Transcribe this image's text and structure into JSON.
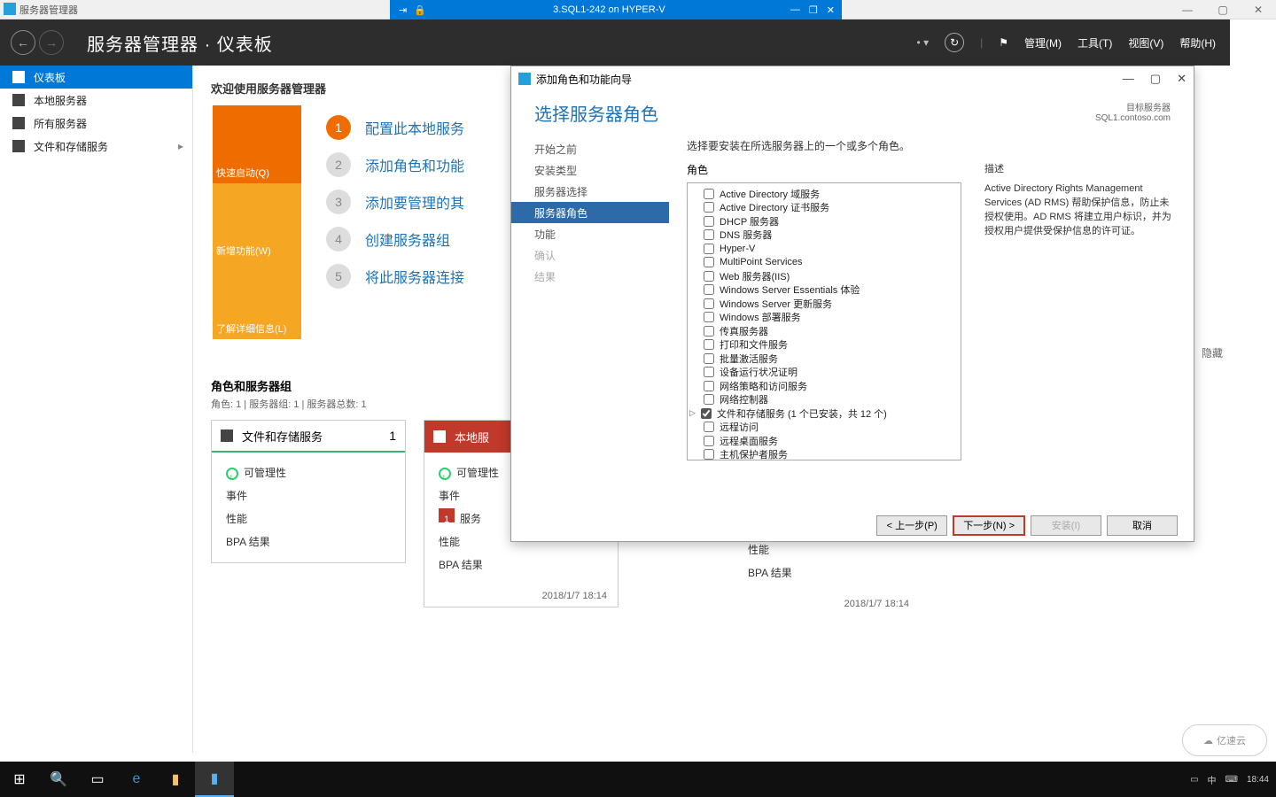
{
  "outer": {
    "app_name": "服务器管理器",
    "hv_title": "3.SQL1-242 on HYPER-V"
  },
  "header": {
    "breadcrumb_a": "服务器管理器",
    "breadcrumb_b": "仪表板",
    "menus": [
      "管理(M)",
      "工具(T)",
      "视图(V)",
      "帮助(H)"
    ]
  },
  "sidebar": {
    "items": [
      {
        "label": "仪表板"
      },
      {
        "label": "本地服务器"
      },
      {
        "label": "所有服务器"
      },
      {
        "label": "文件和存储服务"
      }
    ]
  },
  "main": {
    "welcome": "欢迎使用服务器管理器",
    "tiles": [
      {
        "label": "快速启动(Q)"
      },
      {
        "label": "新增功能(W)"
      },
      {
        "label": "了解详细信息(L)"
      }
    ],
    "steps": [
      "配置此本地服务",
      "添加角色和功能",
      "添加要管理的其",
      "创建服务器组",
      "将此服务器连接"
    ],
    "groups_title": "角色和服务器组",
    "groups_sub": "角色: 1 | 服务器组: 1 | 服务器总数: 1",
    "card1": {
      "title": "文件和存储服务",
      "count": "1",
      "rows": [
        "可管理性",
        "事件",
        "性能",
        "BPA 结果"
      ]
    },
    "card2": {
      "title": "本地服",
      "rows": [
        "可管理性",
        "事件",
        "服务",
        "性能",
        "BPA 结果"
      ],
      "badge": "1",
      "foot": "2018/1/7 18:14"
    },
    "card3": {
      "rows": [
        "性能",
        "BPA 结果"
      ],
      "foot": "2018/1/7 18:14"
    },
    "hide": "隐藏"
  },
  "wizard": {
    "title": "添加角色和功能向导",
    "head_title": "选择服务器角色",
    "target_label": "目标服务器",
    "target_value": "SQL1.contoso.com",
    "nav": [
      "开始之前",
      "安装类型",
      "服务器选择",
      "服务器角色",
      "功能",
      "确认",
      "结果"
    ],
    "intro": "选择要安装在所选服务器上的一个或多个角色。",
    "roles_label": "角色",
    "desc_label": "描述",
    "roles": [
      "Active Directory 域服务",
      "Active Directory 证书服务",
      "DHCP 服务器",
      "DNS 服务器",
      "Hyper-V",
      "MultiPoint Services",
      "Web 服务器(IIS)",
      "Windows Server Essentials 体验",
      "Windows Server 更新服务",
      "Windows 部署服务",
      "传真服务器",
      "打印和文件服务",
      "批量激活服务",
      "设备运行状况证明",
      "网络策略和访问服务",
      "网络控制器",
      "文件和存储服务 (1 个已安装，共 12 个)",
      "远程访问",
      "远程桌面服务",
      "主机保护者服务"
    ],
    "desc": "Active Directory Rights Management Services (AD RMS) 帮助保护信息，防止未授权使用。AD RMS 将建立用户标识，并为授权用户提供受保护信息的许可证。",
    "buttons": {
      "prev": "< 上一步(P)",
      "next": "下一步(N) >",
      "install": "安装(I)",
      "cancel": "取消"
    }
  },
  "taskbar": {
    "time": "18:44",
    "ime": "中",
    "watermark": "亿速云"
  }
}
